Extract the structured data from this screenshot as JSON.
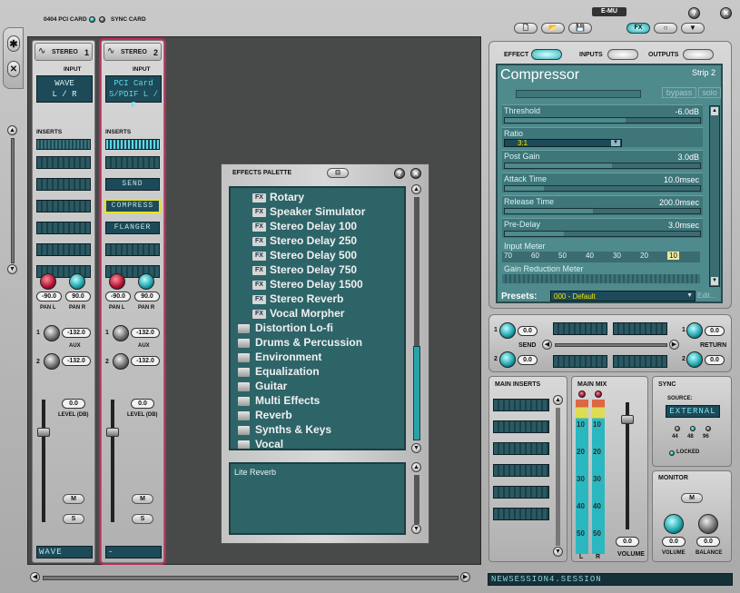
{
  "top_bar": {
    "card_label": "0404 PCI CARD",
    "sync_label": "SYNC CARD"
  },
  "strips": [
    {
      "name": "STEREO",
      "number": "1",
      "input_label": "INPUT",
      "input_line1": "WAVE",
      "input_line2": "L / R",
      "inserts_label": "INSERTS",
      "inserts": [
        "",
        "",
        "",
        "",
        "",
        ""
      ],
      "pan_l": "-90.0",
      "pan_r": "90.0",
      "pan_l_label": "PAN L",
      "pan_r_label": "PAN R",
      "aux_label": "AUX",
      "aux1": "-132.0",
      "aux2": "-132.0",
      "level": "0.0",
      "level_label": "LEVEL (DB)",
      "mute": "M",
      "solo": "S",
      "output": "WAVE"
    },
    {
      "name": "STEREO",
      "number": "2",
      "input_label": "INPUT",
      "input_line1": "PCI Card",
      "input_line2": "S/PDIF L / F",
      "inserts_label": "INSERTS",
      "inserts": [
        "",
        "SEND",
        "COMPRESS",
        "FLANGER",
        "",
        ""
      ],
      "pan_l": "-90.0",
      "pan_r": "90.0",
      "pan_l_label": "PAN L",
      "pan_r_label": "PAN R",
      "aux_label": "AUX",
      "aux1": "-132.0",
      "aux2": "-132.0",
      "level": "0.0",
      "level_label": "LEVEL (DB)",
      "mute": "M",
      "solo": "S",
      "output": "-"
    }
  ],
  "palette": {
    "title": "EFFECTS PALETTE",
    "fx_badge": "FX",
    "effects": [
      "Rotary",
      "Speaker Simulator",
      "Stereo Delay  100",
      "Stereo Delay  250",
      "Stereo Delay  500",
      "Stereo Delay  750",
      "Stereo Delay  1500",
      "Stereo Reverb",
      "Vocal Morpher"
    ],
    "folders": [
      "Distortion Lo-fi",
      "Drums & Percussion",
      "Environment",
      "Equalization",
      "Guitar",
      "Multi Effects",
      "Reverb",
      "Synths & Keys",
      "Vocal"
    ],
    "description": "Lite Reverb"
  },
  "brand": "E-MU",
  "header_buttons": {
    "fx": "FX"
  },
  "tabs": {
    "effect": "EFFECT",
    "inputs": "INPUTS",
    "outputs": "OUTPUTS"
  },
  "effect": {
    "name": "Compressor",
    "strip": "Strip 2",
    "dry": "Dry",
    "wet": "Wet",
    "bypass": "bypass",
    "solo": "solo",
    "params": [
      {
        "name": "Threshold",
        "value": "-6.0dB",
        "fill": 0.62
      },
      {
        "name": "Ratio",
        "value": "3:1",
        "fill": 0.0
      },
      {
        "name": "Post Gain",
        "value": "3.0dB",
        "fill": 0.55
      },
      {
        "name": "Attack Time",
        "value": "10.0msec",
        "fill": 0.2
      },
      {
        "name": "Release Time",
        "value": "200.0msec",
        "fill": 0.45
      },
      {
        "name": "Pre-Delay",
        "value": "3.0msec",
        "fill": 0.3
      }
    ],
    "input_meter_label": "Input Meter",
    "input_meter_ticks": [
      "70",
      "60",
      "50",
      "40",
      "30",
      "20",
      "10"
    ],
    "gr_meter_label": "Gain Reduction Meter",
    "presets_label": "Presets:",
    "preset_value": "000 - Default",
    "edit_label": "Edit..."
  },
  "send_return": {
    "send_label": "SEND",
    "return_label": "RETURN",
    "send1": "0.0",
    "send2": "0.0",
    "return1": "0.0",
    "return2": "0.0"
  },
  "main_inserts": {
    "label": "MAIN INSERTS"
  },
  "main_mix": {
    "label": "MAIN MIX",
    "ticks": [
      "10",
      "20",
      "30",
      "40",
      "50",
      "10",
      "20",
      "30",
      "40",
      "50"
    ],
    "l": "L",
    "r": "R",
    "volume": "0.0",
    "volume_label": "VOLUME"
  },
  "sync": {
    "label": "SYNC",
    "source_label": "SOURCE:",
    "source": "EXTERNAL",
    "rates": [
      "44",
      "48",
      "96"
    ],
    "locked": "LOCKED"
  },
  "monitor": {
    "label": "MONITOR",
    "mute": "M",
    "volume": "0.0",
    "volume_label": "VOLUME",
    "balance": "0.0",
    "balance_label": "BALANCE"
  },
  "session": "NEWSESSION4.SESSION",
  "colors": {
    "lcd": "#1d4a58",
    "lcd_text": "#7fe6f0",
    "selected_strip": "#c2285a",
    "panel_teal": "#2d6468"
  }
}
